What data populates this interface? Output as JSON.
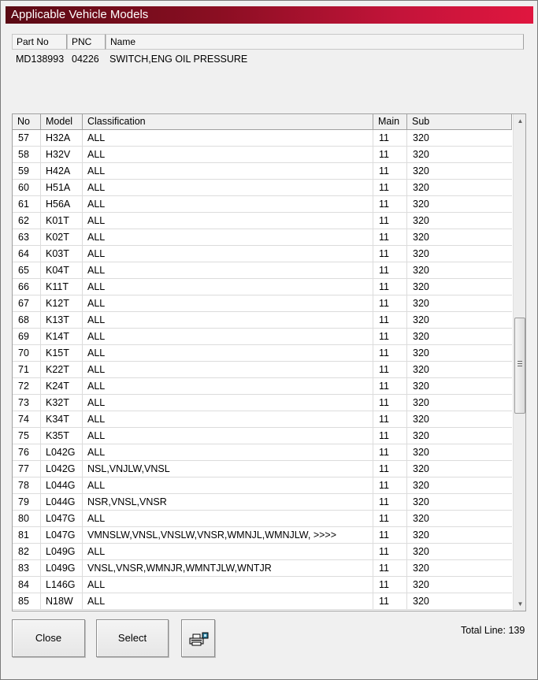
{
  "window": {
    "title": "Applicable Vehicle Models"
  },
  "part": {
    "headers": {
      "part_no": "Part No",
      "pnc": "PNC",
      "name": "Name"
    },
    "values": {
      "part_no": "MD138993",
      "pnc": "04226",
      "name": "SWITCH,ENG OIL PRESSURE"
    }
  },
  "grid": {
    "headers": {
      "no": "No",
      "model": "Model",
      "classification": "Classification",
      "main": "Main",
      "sub": "Sub"
    },
    "rows": [
      {
        "no": "57",
        "model": "H32A",
        "classification": "ALL",
        "main": "11",
        "sub": "320"
      },
      {
        "no": "58",
        "model": "H32V",
        "classification": "ALL",
        "main": "11",
        "sub": "320"
      },
      {
        "no": "59",
        "model": "H42A",
        "classification": "ALL",
        "main": "11",
        "sub": "320"
      },
      {
        "no": "60",
        "model": "H51A",
        "classification": "ALL",
        "main": "11",
        "sub": "320"
      },
      {
        "no": "61",
        "model": "H56A",
        "classification": "ALL",
        "main": "11",
        "sub": "320"
      },
      {
        "no": "62",
        "model": "K01T",
        "classification": "ALL",
        "main": "11",
        "sub": "320"
      },
      {
        "no": "63",
        "model": "K02T",
        "classification": "ALL",
        "main": "11",
        "sub": "320"
      },
      {
        "no": "64",
        "model": "K03T",
        "classification": "ALL",
        "main": "11",
        "sub": "320"
      },
      {
        "no": "65",
        "model": "K04T",
        "classification": "ALL",
        "main": "11",
        "sub": "320"
      },
      {
        "no": "66",
        "model": "K11T",
        "classification": "ALL",
        "main": "11",
        "sub": "320"
      },
      {
        "no": "67",
        "model": "K12T",
        "classification": "ALL",
        "main": "11",
        "sub": "320"
      },
      {
        "no": "68",
        "model": "K13T",
        "classification": "ALL",
        "main": "11",
        "sub": "320"
      },
      {
        "no": "69",
        "model": "K14T",
        "classification": "ALL",
        "main": "11",
        "sub": "320"
      },
      {
        "no": "70",
        "model": "K15T",
        "classification": "ALL",
        "main": "11",
        "sub": "320"
      },
      {
        "no": "71",
        "model": "K22T",
        "classification": "ALL",
        "main": "11",
        "sub": "320"
      },
      {
        "no": "72",
        "model": "K24T",
        "classification": "ALL",
        "main": "11",
        "sub": "320"
      },
      {
        "no": "73",
        "model": "K32T",
        "classification": "ALL",
        "main": "11",
        "sub": "320"
      },
      {
        "no": "74",
        "model": "K34T",
        "classification": "ALL",
        "main": "11",
        "sub": "320"
      },
      {
        "no": "75",
        "model": "K35T",
        "classification": "ALL",
        "main": "11",
        "sub": "320"
      },
      {
        "no": "76",
        "model": "L042G",
        "classification": "ALL",
        "main": "11",
        "sub": "320"
      },
      {
        "no": "77",
        "model": "L042G",
        "classification": "NSL,VNJLW,VNSL",
        "main": "11",
        "sub": "320"
      },
      {
        "no": "78",
        "model": "L044G",
        "classification": "ALL",
        "main": "11",
        "sub": "320"
      },
      {
        "no": "79",
        "model": "L044G",
        "classification": "NSR,VNSL,VNSR",
        "main": "11",
        "sub": "320"
      },
      {
        "no": "80",
        "model": "L047G",
        "classification": "ALL",
        "main": "11",
        "sub": "320"
      },
      {
        "no": "81",
        "model": "L047G",
        "classification": "VMNSLW,VNSL,VNSLW,VNSR,WMNJL,WMNJLW,  >>>>",
        "main": "11",
        "sub": "320"
      },
      {
        "no": "82",
        "model": "L049G",
        "classification": "ALL",
        "main": "11",
        "sub": "320"
      },
      {
        "no": "83",
        "model": "L049G",
        "classification": "VNSL,VNSR,WMNJR,WMNTJLW,WNTJR",
        "main": "11",
        "sub": "320"
      },
      {
        "no": "84",
        "model": "L146G",
        "classification": "ALL",
        "main": "11",
        "sub": "320"
      },
      {
        "no": "85",
        "model": "N18W",
        "classification": "ALL",
        "main": "11",
        "sub": "320"
      }
    ]
  },
  "scrollbar": {
    "up_icon": "scroll-up-arrow-icon",
    "down_icon": "scroll-down-arrow-icon"
  },
  "buttons": {
    "close": "Close",
    "select": "Select",
    "print_icon": "printer-icon"
  },
  "status": {
    "total_line": "Total Line: 139"
  },
  "colors": {
    "title_dark": "#5a0a14",
    "title_light": "#e0163f"
  }
}
